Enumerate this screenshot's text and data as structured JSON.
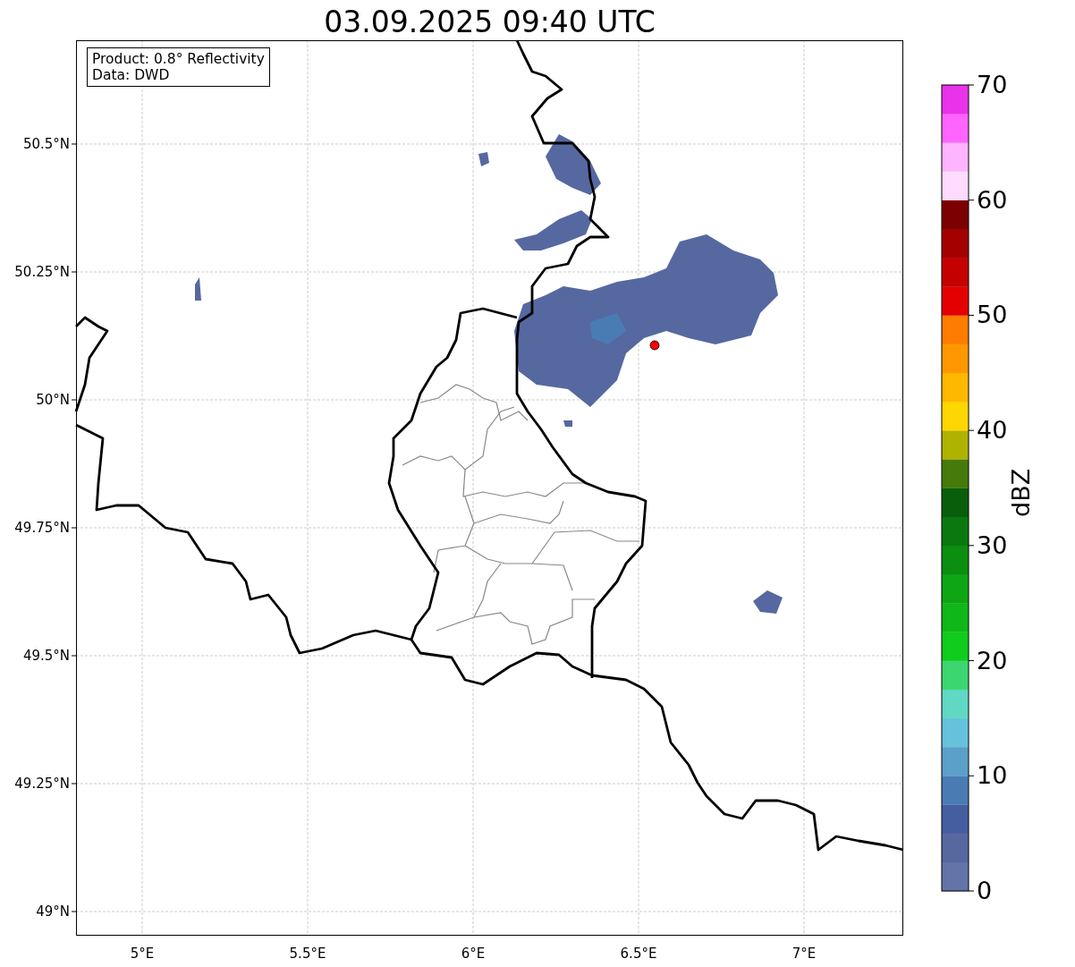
{
  "title": "03.09.2025 09:40 UTC",
  "info_box": [
    "Product: 0.8° Reflectivity",
    "Data: DWD"
  ],
  "map": {
    "lat_labels": [
      "50.5°N",
      "50.25°N",
      "50°N",
      "49.75°N",
      "49.5°N",
      "49.25°N",
      "49°N"
    ],
    "lon_labels": [
      "5°E",
      "5.5°E",
      "6°E",
      "6.5°E",
      "7°E"
    ]
  },
  "colorbar": {
    "label": "dBZ",
    "tick_labels": [
      "70",
      "60",
      "50",
      "40",
      "30",
      "20",
      "10",
      "0"
    ],
    "bins": [
      {
        "color": "#6474a8"
      },
      {
        "color": "#5668a0"
      },
      {
        "color": "#445ea0"
      },
      {
        "color": "#4a7cb4"
      },
      {
        "color": "#5ba0c8"
      },
      {
        "color": "#66c2dc"
      },
      {
        "color": "#60d8c4"
      },
      {
        "color": "#3cd670"
      },
      {
        "color": "#10cc1c"
      },
      {
        "color": "#0fb818"
      },
      {
        "color": "#0ea614"
      },
      {
        "color": "#0c8e10"
      },
      {
        "color": "#0a780e"
      },
      {
        "color": "#085e0a"
      },
      {
        "color": "#467a0a"
      },
      {
        "color": "#b0b200"
      },
      {
        "color": "#ffd700"
      },
      {
        "color": "#ffb800"
      },
      {
        "color": "#ff9800"
      },
      {
        "color": "#ff7c00"
      },
      {
        "color": "#e40000"
      },
      {
        "color": "#c40000"
      },
      {
        "color": "#a40000"
      },
      {
        "color": "#7c0000"
      },
      {
        "color": "#ffdcff"
      },
      {
        "color": "#ffb4ff"
      },
      {
        "color": "#ff64ff"
      },
      {
        "color": "#ea32ea"
      }
    ]
  }
}
